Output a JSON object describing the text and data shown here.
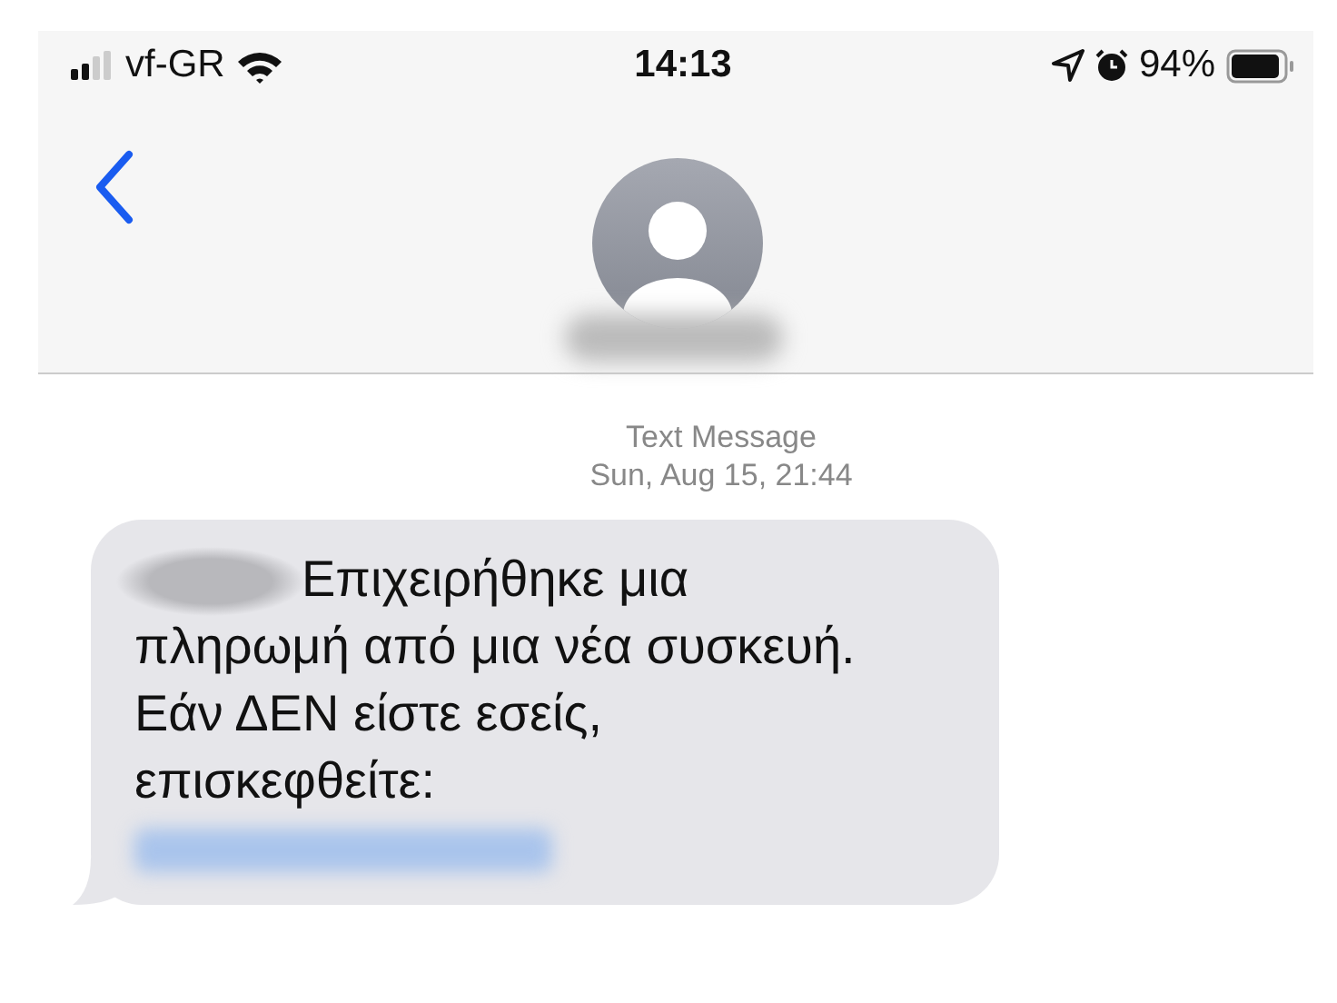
{
  "status_bar": {
    "carrier": "vf-GR",
    "time": "14:13",
    "battery_percent": "94%"
  },
  "thread": {
    "service": "Text Message",
    "timestamp": "Sun, Aug 15, 21:44"
  },
  "messages": [
    {
      "text": "Επιχειρήθηκε μια πληρωμή από μια νέα συσκευή. Εάν ΔΕΝ είστε εσείς, επισκεφθείτε:"
    }
  ]
}
